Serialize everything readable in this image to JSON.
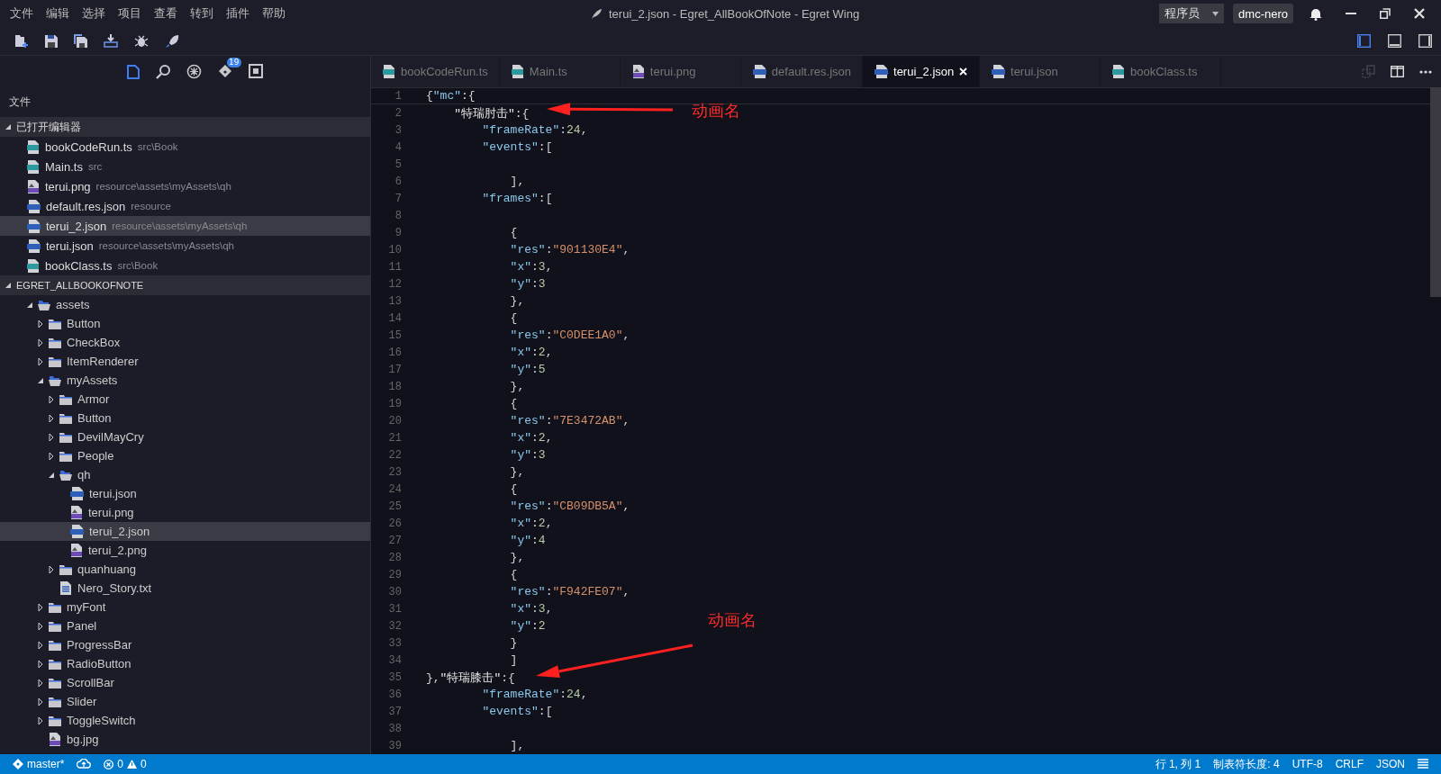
{
  "window": {
    "title": "terui_2.json - Egret_AllBookOfNote - Egret Wing"
  },
  "menu": [
    "文件",
    "编辑",
    "选择",
    "项目",
    "查看",
    "转到",
    "插件",
    "帮助"
  ],
  "role_selector": {
    "value": "程序员"
  },
  "user": "dmc-nero",
  "toolbar": [
    {
      "kind": "new-folder"
    },
    {
      "kind": "save"
    },
    {
      "kind": "save-all"
    },
    {
      "kind": "download"
    },
    {
      "kind": "debug"
    },
    {
      "kind": "launch"
    }
  ],
  "layout_buttons": [
    {
      "kind": "left",
      "selected": true
    },
    {
      "kind": "bottom",
      "selected": false
    },
    {
      "kind": "right",
      "selected": false
    }
  ],
  "activity_bar": [
    {
      "kind": "files",
      "selected": true
    },
    {
      "kind": "search",
      "selected": false
    },
    {
      "kind": "debug",
      "selected": false
    },
    {
      "kind": "git",
      "selected": false,
      "badge": "19"
    },
    {
      "kind": "extensions",
      "selected": false
    }
  ],
  "sidebar": {
    "title": "文件",
    "open_editors": {
      "title": "已打开编辑器",
      "expanded": true,
      "items": [
        {
          "name": "bookCodeRun.ts",
          "path": "src\\Book",
          "kind": "ts",
          "selected": false
        },
        {
          "name": "Main.ts",
          "path": "src",
          "kind": "ts",
          "selected": false
        },
        {
          "name": "terui.png",
          "path": "resource\\assets\\myAssets\\qh",
          "kind": "png",
          "selected": false
        },
        {
          "name": "default.res.json",
          "path": "resource",
          "kind": "json",
          "selected": false
        },
        {
          "name": "terui_2.json",
          "path": "resource\\assets\\myAssets\\qh",
          "kind": "json",
          "selected": true
        },
        {
          "name": "terui.json",
          "path": "resource\\assets\\myAssets\\qh",
          "kind": "json",
          "selected": false
        },
        {
          "name": "bookClass.ts",
          "path": "src\\Book",
          "kind": "ts",
          "selected": false
        }
      ]
    },
    "project": {
      "title": "EGRET_ALLBOOKOFNOTE",
      "expanded": true,
      "tree": [
        {
          "name": "assets",
          "kind": "folder",
          "expanded": true,
          "selected": false,
          "children": [
            {
              "name": "Button",
              "kind": "folder",
              "expanded": false,
              "selected": false
            },
            {
              "name": "CheckBox",
              "kind": "folder",
              "expanded": false,
              "selected": false
            },
            {
              "name": "ItemRenderer",
              "kind": "folder",
              "expanded": false,
              "selected": false
            },
            {
              "name": "myAssets",
              "kind": "folder",
              "expanded": true,
              "selected": false,
              "children": [
                {
                  "name": "Armor",
                  "kind": "folder",
                  "expanded": false,
                  "selected": false
                },
                {
                  "name": "Button",
                  "kind": "folder",
                  "expanded": false,
                  "selected": false
                },
                {
                  "name": "DevilMayCry",
                  "kind": "folder",
                  "expanded": false,
                  "selected": false
                },
                {
                  "name": "People",
                  "kind": "folder",
                  "expanded": false,
                  "selected": false
                },
                {
                  "name": "qh",
                  "kind": "folder",
                  "expanded": true,
                  "selected": false,
                  "children": [
                    {
                      "name": "terui.json",
                      "kind": "json",
                      "selected": false
                    },
                    {
                      "name": "terui.png",
                      "kind": "png",
                      "selected": false
                    },
                    {
                      "name": "terui_2.json",
                      "kind": "json",
                      "selected": true
                    },
                    {
                      "name": "terui_2.png",
                      "kind": "png",
                      "selected": false
                    }
                  ]
                },
                {
                  "name": "quanhuang",
                  "kind": "folder",
                  "expanded": false,
                  "selected": false
                },
                {
                  "name": "Nero_Story.txt",
                  "kind": "txt",
                  "selected": false
                }
              ]
            },
            {
              "name": "myFont",
              "kind": "folder",
              "expanded": false,
              "selected": false
            },
            {
              "name": "Panel",
              "kind": "folder",
              "expanded": false,
              "selected": false
            },
            {
              "name": "ProgressBar",
              "kind": "folder",
              "expanded": false,
              "selected": false
            },
            {
              "name": "RadioButton",
              "kind": "folder",
              "expanded": false,
              "selected": false
            },
            {
              "name": "ScrollBar",
              "kind": "folder",
              "expanded": false,
              "selected": false
            },
            {
              "name": "Slider",
              "kind": "folder",
              "expanded": false,
              "selected": false
            },
            {
              "name": "ToggleSwitch",
              "kind": "folder",
              "expanded": false,
              "selected": false
            },
            {
              "name": "bg.jpg",
              "kind": "png",
              "selected": false
            }
          ]
        }
      ]
    }
  },
  "tabs": [
    {
      "label": "bookCodeRun.ts",
      "kind": "ts",
      "selected": false
    },
    {
      "label": "Main.ts",
      "kind": "ts",
      "selected": false
    },
    {
      "label": "terui.png",
      "kind": "png",
      "selected": false
    },
    {
      "label": "default.res.json",
      "kind": "json",
      "selected": false
    },
    {
      "label": "terui_2.json",
      "kind": "json",
      "selected": true
    },
    {
      "label": "terui.json",
      "kind": "json",
      "selected": false
    },
    {
      "label": "bookClass.ts",
      "kind": "ts",
      "selected": false
    }
  ],
  "editor": {
    "lines": [
      {
        "number": "1",
        "tokens": [
          {
            "kind": "punct",
            "text": "{"
          },
          {
            "kind": "key",
            "text": "\"mc\""
          },
          {
            "kind": "punct",
            "text": ":{"
          }
        ]
      },
      {
        "number": "2",
        "tokens": [
          {
            "kind": "name",
            "text": "    \"特瑞肘击\""
          },
          {
            "kind": "punct",
            "text": ":{"
          }
        ]
      },
      {
        "number": "3",
        "tokens": [
          {
            "kind": "key",
            "text": "        \"frameRate\""
          },
          {
            "kind": "punct",
            "text": ":"
          },
          {
            "kind": "num",
            "text": "24"
          },
          {
            "kind": "punct",
            "text": ","
          }
        ]
      },
      {
        "number": "4",
        "tokens": [
          {
            "kind": "key",
            "text": "        \"events\""
          },
          {
            "kind": "punct",
            "text": ":["
          }
        ]
      },
      {
        "number": "5"
      },
      {
        "number": "6",
        "tokens": [
          {
            "kind": "punct",
            "text": "            ],"
          }
        ]
      },
      {
        "number": "7",
        "tokens": [
          {
            "kind": "key",
            "text": "        \"frames\""
          },
          {
            "kind": "punct",
            "text": ":["
          }
        ]
      },
      {
        "number": "8"
      },
      {
        "number": "9",
        "tokens": [
          {
            "kind": "punct",
            "text": "            {"
          }
        ]
      },
      {
        "number": "10",
        "tokens": [
          {
            "kind": "key",
            "text": "            \"res\""
          },
          {
            "kind": "punct",
            "text": ":"
          },
          {
            "kind": "str",
            "text": "\"901130E4\""
          },
          {
            "kind": "punct",
            "text": ","
          }
        ]
      },
      {
        "number": "11",
        "tokens": [
          {
            "kind": "key",
            "text": "            \"x\""
          },
          {
            "kind": "punct",
            "text": ":"
          },
          {
            "kind": "num",
            "text": "3"
          },
          {
            "kind": "punct",
            "text": ","
          }
        ]
      },
      {
        "number": "12",
        "tokens": [
          {
            "kind": "key",
            "text": "            \"y\""
          },
          {
            "kind": "punct",
            "text": ":"
          },
          {
            "kind": "num",
            "text": "3"
          }
        ]
      },
      {
        "number": "13",
        "tokens": [
          {
            "kind": "punct",
            "text": "            },"
          }
        ]
      },
      {
        "number": "14",
        "tokens": [
          {
            "kind": "punct",
            "text": "            {"
          }
        ]
      },
      {
        "number": "15",
        "tokens": [
          {
            "kind": "key",
            "text": "            \"res\""
          },
          {
            "kind": "punct",
            "text": ":"
          },
          {
            "kind": "str",
            "text": "\"C0DEE1A0\""
          },
          {
            "kind": "punct",
            "text": ","
          }
        ]
      },
      {
        "number": "16",
        "tokens": [
          {
            "kind": "key",
            "text": "            \"x\""
          },
          {
            "kind": "punct",
            "text": ":"
          },
          {
            "kind": "num",
            "text": "2"
          },
          {
            "kind": "punct",
            "text": ","
          }
        ]
      },
      {
        "number": "17",
        "tokens": [
          {
            "kind": "key",
            "text": "            \"y\""
          },
          {
            "kind": "punct",
            "text": ":"
          },
          {
            "kind": "num",
            "text": "5"
          }
        ]
      },
      {
        "number": "18",
        "tokens": [
          {
            "kind": "punct",
            "text": "            },"
          }
        ]
      },
      {
        "number": "19",
        "tokens": [
          {
            "kind": "punct",
            "text": "            {"
          }
        ]
      },
      {
        "number": "20",
        "tokens": [
          {
            "kind": "key",
            "text": "            \"res\""
          },
          {
            "kind": "punct",
            "text": ":"
          },
          {
            "kind": "str",
            "text": "\"7E3472AB\""
          },
          {
            "kind": "punct",
            "text": ","
          }
        ]
      },
      {
        "number": "21",
        "tokens": [
          {
            "kind": "key",
            "text": "            \"x\""
          },
          {
            "kind": "punct",
            "text": ":"
          },
          {
            "kind": "num",
            "text": "2"
          },
          {
            "kind": "punct",
            "text": ","
          }
        ]
      },
      {
        "number": "22",
        "tokens": [
          {
            "kind": "key",
            "text": "            \"y\""
          },
          {
            "kind": "punct",
            "text": ":"
          },
          {
            "kind": "num",
            "text": "3"
          }
        ]
      },
      {
        "number": "23",
        "tokens": [
          {
            "kind": "punct",
            "text": "            },"
          }
        ]
      },
      {
        "number": "24",
        "tokens": [
          {
            "kind": "punct",
            "text": "            {"
          }
        ]
      },
      {
        "number": "25",
        "tokens": [
          {
            "kind": "key",
            "text": "            \"res\""
          },
          {
            "kind": "punct",
            "text": ":"
          },
          {
            "kind": "str",
            "text": "\"CB09DB5A\""
          },
          {
            "kind": "punct",
            "text": ","
          }
        ]
      },
      {
        "number": "26",
        "tokens": [
          {
            "kind": "key",
            "text": "            \"x\""
          },
          {
            "kind": "punct",
            "text": ":"
          },
          {
            "kind": "num",
            "text": "2"
          },
          {
            "kind": "punct",
            "text": ","
          }
        ]
      },
      {
        "number": "27",
        "tokens": [
          {
            "kind": "key",
            "text": "            \"y\""
          },
          {
            "kind": "punct",
            "text": ":"
          },
          {
            "kind": "num",
            "text": "4"
          }
        ]
      },
      {
        "number": "28",
        "tokens": [
          {
            "kind": "punct",
            "text": "            },"
          }
        ]
      },
      {
        "number": "29",
        "tokens": [
          {
            "kind": "punct",
            "text": "            {"
          }
        ]
      },
      {
        "number": "30",
        "tokens": [
          {
            "kind": "key",
            "text": "            \"res\""
          },
          {
            "kind": "punct",
            "text": ":"
          },
          {
            "kind": "str",
            "text": "\"F942FE07\""
          },
          {
            "kind": "punct",
            "text": ","
          }
        ]
      },
      {
        "number": "31",
        "tokens": [
          {
            "kind": "key",
            "text": "            \"x\""
          },
          {
            "kind": "punct",
            "text": ":"
          },
          {
            "kind": "num",
            "text": "3"
          },
          {
            "kind": "punct",
            "text": ","
          }
        ]
      },
      {
        "number": "32",
        "tokens": [
          {
            "kind": "key",
            "text": "            \"y\""
          },
          {
            "kind": "punct",
            "text": ":"
          },
          {
            "kind": "num",
            "text": "2"
          }
        ]
      },
      {
        "number": "33",
        "tokens": [
          {
            "kind": "punct",
            "text": "            }"
          }
        ]
      },
      {
        "number": "34",
        "tokens": [
          {
            "kind": "punct",
            "text": "            ]"
          }
        ]
      },
      {
        "number": "35",
        "tokens": [
          {
            "kind": "punct",
            "text": "},"
          },
          {
            "kind": "name",
            "text": "\"特瑞膝击\""
          },
          {
            "kind": "punct",
            "text": ":{"
          }
        ]
      },
      {
        "number": "36",
        "tokens": [
          {
            "kind": "key",
            "text": "        \"frameRate\""
          },
          {
            "kind": "punct",
            "text": ":"
          },
          {
            "kind": "num",
            "text": "24"
          },
          {
            "kind": "punct",
            "text": ","
          }
        ]
      },
      {
        "number": "37",
        "tokens": [
          {
            "kind": "key",
            "text": "        \"events\""
          },
          {
            "kind": "punct",
            "text": ":["
          }
        ]
      },
      {
        "number": "38"
      },
      {
        "number": "39",
        "tokens": [
          {
            "kind": "punct",
            "text": "            ],"
          }
        ]
      }
    ]
  },
  "annotations": [
    {
      "text": "动画名"
    },
    {
      "text": "动画名"
    }
  ],
  "status_bar": {
    "branch": "master*",
    "errors": "0",
    "warnings": "0",
    "cursor": "行 1, 列 1",
    "tab_size": "制表符长度: 4",
    "encoding": "UTF-8",
    "line_ending": "CRLF",
    "language": "JSON"
  }
}
